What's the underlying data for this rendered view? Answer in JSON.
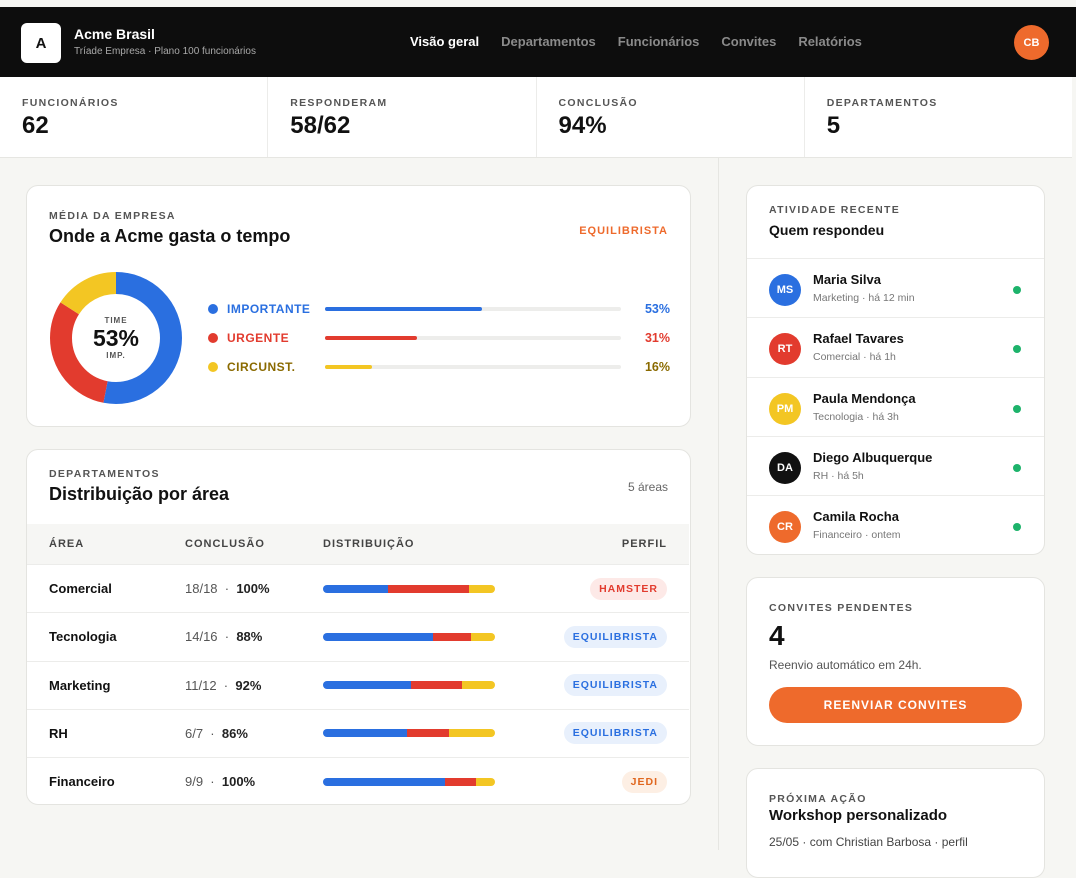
{
  "app": {
    "logo_letter": "A",
    "name": "Acme Brasil",
    "subtitle": "Tríade Empresa · Plano 100 funcionários",
    "user_initials": "CB"
  },
  "nav": [
    {
      "label": "Visão geral",
      "active": true
    },
    {
      "label": "Departamentos"
    },
    {
      "label": "Funcionários"
    },
    {
      "label": "Convites"
    },
    {
      "label": "Relatórios"
    }
  ],
  "stats": [
    {
      "label": "FUNCIONÁRIOS",
      "value": "62"
    },
    {
      "label": "RESPONDERAM",
      "value": "58/62"
    },
    {
      "label": "CONCLUSÃO",
      "value": "94%"
    },
    {
      "label": "DEPARTAMENTOS",
      "value": "5"
    }
  ],
  "company": {
    "eyebrow": "MÉDIA DA EMPRESA",
    "title": "Onde a Acme gasta o tempo",
    "profile": "EQUILIBRISTA",
    "donut": {
      "top": "TIME",
      "value": "53%",
      "bottom": "IMP."
    },
    "legend": [
      {
        "label": "IMPORTANTE",
        "value": 53,
        "pct": "53%",
        "color": "#2a6fe0"
      },
      {
        "label": "URGENTE",
        "value": 31,
        "pct": "31%",
        "color": "#e23b2e"
      },
      {
        "label": "CIRCUNST.",
        "value": 16,
        "pct": "16%",
        "color": "#f3c623"
      }
    ]
  },
  "departments": {
    "eyebrow": "DEPARTAMENTOS",
    "title": "Distribuição por área",
    "count": "5 áreas",
    "headers": {
      "area": "ÁREA",
      "conclusao": "CONCLUSÃO",
      "distribuicao": "DISTRIBUIÇÃO",
      "perfil": "PERFIL"
    },
    "rows": [
      {
        "area": "Comercial",
        "ratio": "18/18",
        "pct": "100%",
        "dist": [
          38,
          47,
          15
        ],
        "profile": "HAMSTER",
        "profile_type": "hamster"
      },
      {
        "area": "Tecnologia",
        "ratio": "14/16",
        "pct": "88%",
        "dist": [
          64,
          22,
          14
        ],
        "profile": "EQUILIBRISTA",
        "profile_type": "equi"
      },
      {
        "area": "Marketing",
        "ratio": "11/12",
        "pct": "92%",
        "dist": [
          51,
          30,
          19
        ],
        "profile": "EQUILIBRISTA",
        "profile_type": "equi"
      },
      {
        "area": "RH",
        "ratio": "6/7",
        "pct": "86%",
        "dist": [
          49,
          24,
          27
        ],
        "profile": "EQUILIBRISTA",
        "profile_type": "equi"
      },
      {
        "area": "Financeiro",
        "ratio": "9/9",
        "pct": "100%",
        "dist": [
          71,
          18,
          11
        ],
        "profile": "JEDI",
        "profile_type": "jedi"
      }
    ]
  },
  "activity": {
    "eyebrow": "ATIVIDADE RECENTE",
    "title": "Quem respondeu",
    "items": [
      {
        "initials": "MS",
        "name": "Maria Silva",
        "meta": "Marketing · há 12 min",
        "color": "#2a6fe0"
      },
      {
        "initials": "RT",
        "name": "Rafael Tavares",
        "meta": "Comercial · há 1h",
        "color": "#e23b2e"
      },
      {
        "initials": "PM",
        "name": "Paula Mendonça",
        "meta": "Tecnologia · há 3h",
        "color": "#f3c623"
      },
      {
        "initials": "DA",
        "name": "Diego Albuquerque",
        "meta": "RH · há 5h",
        "color": "#111111"
      },
      {
        "initials": "CR",
        "name": "Camila Rocha",
        "meta": "Financeiro · ontem",
        "color": "#ee6a2c"
      }
    ]
  },
  "invites": {
    "eyebrow": "CONVITES PENDENTES",
    "count": "4",
    "note": "Reenvio automático em 24h.",
    "button": "REENVIAR CONVITES"
  },
  "next_action": {
    "eyebrow": "PRÓXIMA AÇÃO",
    "title": "Workshop personalizado",
    "meta": "25/05 · com Christian Barbosa · perfil"
  },
  "colors": {
    "important": "#2a6fe0",
    "urgent": "#e23b2e",
    "circumstantial": "#f3c623",
    "accent": "#ee6a2c"
  }
}
